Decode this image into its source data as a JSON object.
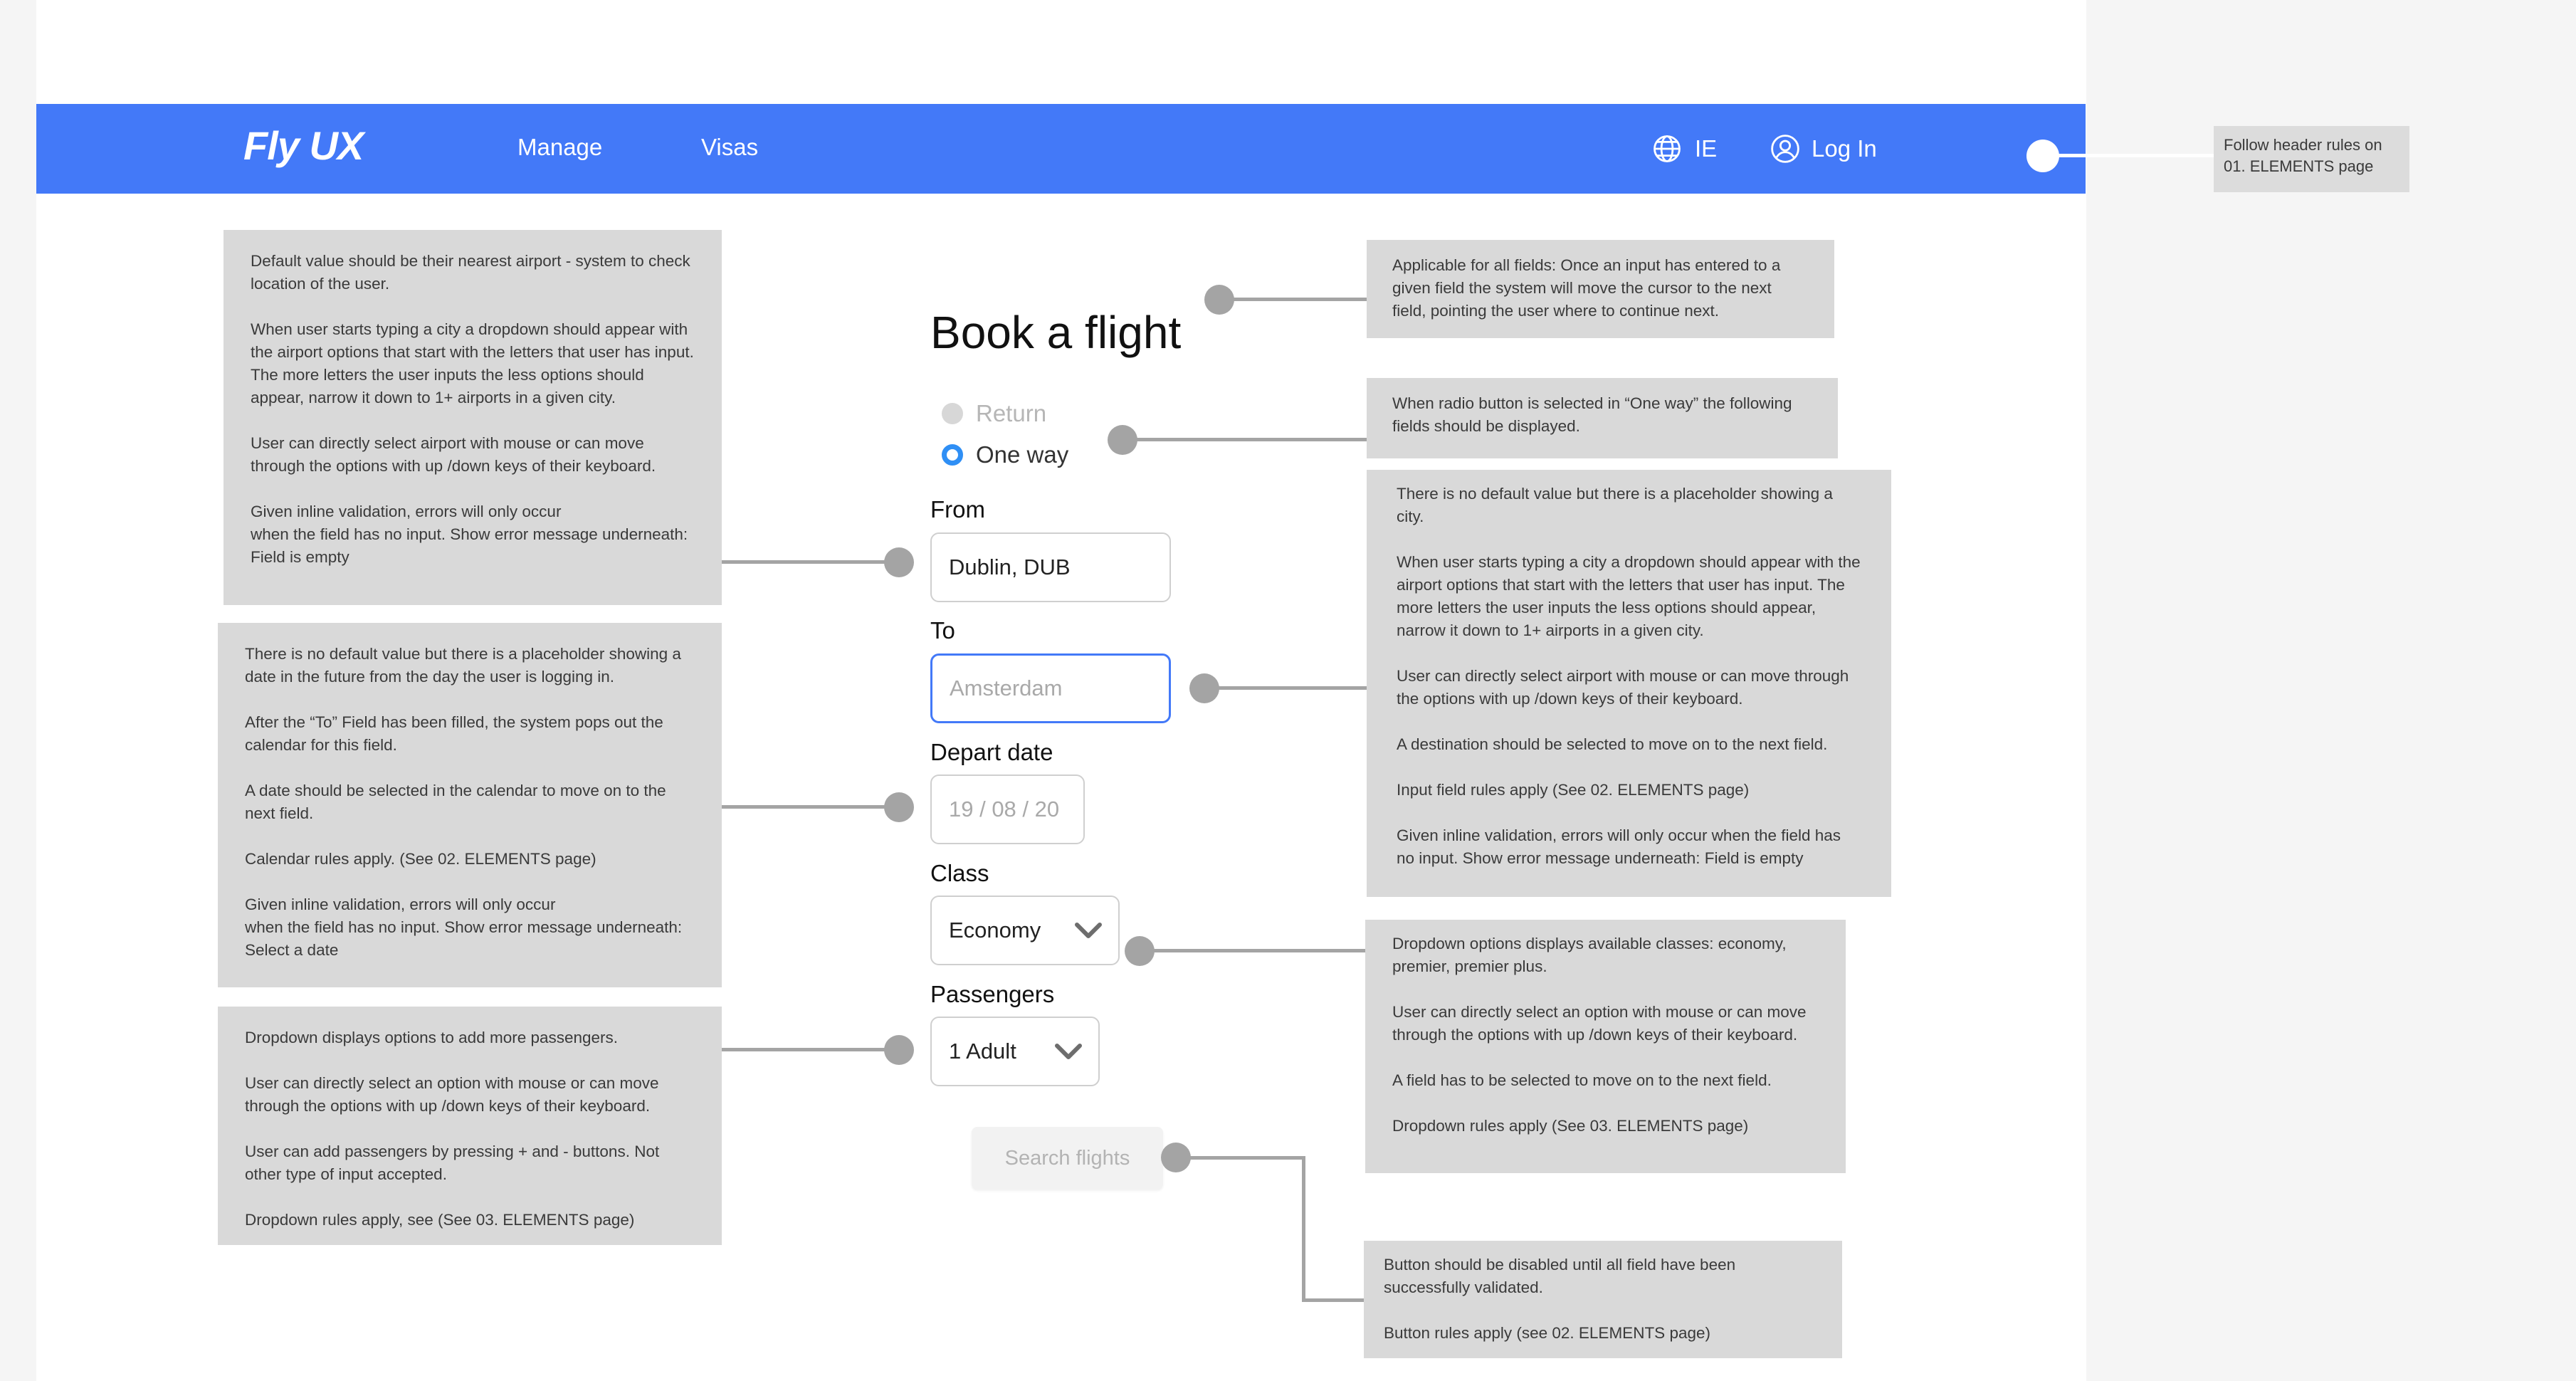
{
  "header": {
    "logo": "Fly UX",
    "nav": [
      "Manage",
      "Visas"
    ],
    "locale": "IE",
    "login": "Log In",
    "icons": [
      "globe-icon",
      "user-icon"
    ],
    "color": "#4379f8"
  },
  "form": {
    "title": "Book a flight",
    "trip_options": [
      "Return",
      "One way"
    ],
    "selected_trip": "One way",
    "from_label": "From",
    "from_value": "Dublin, DUB",
    "to_label": "To",
    "to_placeholder": "Amsterdam",
    "depart_label": "Depart date",
    "depart_placeholder": "19 / 08 / 20",
    "class_label": "Class",
    "class_value": "Economy",
    "passengers_label": "Passengers",
    "passengers_value": "1 Adult",
    "search_button": "Search flights"
  },
  "notes": {
    "header": "Follow header rules on\n01. ELEMENTS page",
    "fields": "Applicable for all fields: Once an input has entered to a given field the system will move the cursor to the next field, pointing the user where to continue next.",
    "radio": "When radio button is selected in “One way”  the following fields should be displayed.",
    "from": [
      "Default value should be their nearest airport - system to check location of the user.",
      "When user starts typing a city a dropdown should appear with the airport options that start with the letters that user has input. The more letters the user inputs the less options should appear, narrow it down to 1+ airports in a given city.",
      "User can directly select airport with mouse or can move through the options with up /down keys of their keyboard.",
      "Given inline validation, errors will only occur\nwhen the field has no input. Show error message underneath: Field is empty"
    ],
    "to": [
      "There is no default value but there is a placeholder showing a city.",
      "When user starts typing a city a dropdown should appear with the airport options that start with the letters that user has input. The more letters the user inputs the less options should appear, narrow it down to 1+ airports in a given city.",
      "User can directly select airport with mouse or can move through the options with up /down keys of their keyboard.",
      "A destination should be selected to move on to the next field.",
      "Input field rules apply (See 02.  ELEMENTS page)",
      "Given inline validation, errors will only occur when the field has no input. Show error message underneath: Field is empty"
    ],
    "depart": [
      "There is no default value but there is a placeholder showing a date in the future from the day the user is logging in.",
      "After the “To” Field has been filled, the system pops out the calendar for this field.",
      "A date should be selected in the calendar to move on to the next field.",
      "Calendar rules apply. (See 02.  ELEMENTS page)",
      "Given inline validation, errors will only occur\nwhen the field has no input. Show error message underneath: Select a date"
    ],
    "class": [
      "Dropdown options displays available classes: economy, premier, premier plus.",
      "User can directly select an option with mouse or can move through the options with up /down keys of their keyboard.",
      "A field has to be selected to move on to the next field.",
      "Dropdown rules apply (See 03.  ELEMENTS page)"
    ],
    "passengers": [
      "Dropdown displays options to add more passengers.",
      "User can directly select an option with mouse or can move through the options with up /down keys of their keyboard.",
      "User can add passengers by pressing + and - buttons. Not other type of input accepted.",
      "Dropdown rules apply, see (See 03.  ELEMENTS page)"
    ],
    "button": [
      "Button should be disabled until all field have been successfully validated.",
      "Button rules apply (see 02. ELEMENTS page)"
    ]
  }
}
